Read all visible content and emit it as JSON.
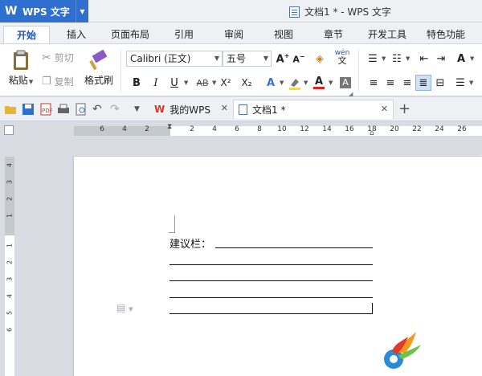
{
  "app": {
    "name": "WPS 文字",
    "window_title": "文档1 * - WPS 文字"
  },
  "ribbon_tabs": [
    {
      "label": "开始",
      "active": true
    },
    {
      "label": "插入"
    },
    {
      "label": "页面布局"
    },
    {
      "label": "引用"
    },
    {
      "label": "审阅"
    },
    {
      "label": "视图"
    },
    {
      "label": "章节"
    },
    {
      "label": "开发工具"
    },
    {
      "label": "特色功能"
    }
  ],
  "ribbon": {
    "paste_label": "粘贴",
    "cut_label": "剪切",
    "copy_label": "复制",
    "format_painter_label": "格式刷",
    "font_name": "Calibri (正文)",
    "font_size": "五号",
    "bold": "B",
    "italic": "I",
    "underline": "U",
    "strike": "AB",
    "superscript": "X²",
    "subscript": "X₂",
    "font_color_letter": "A",
    "pinyin_label": "wén",
    "pinyin_char": "文"
  },
  "quick_access": {
    "doc_tabs": [
      {
        "label": "我的WPS",
        "active": false
      },
      {
        "label": "文档1 *",
        "active": true
      }
    ],
    "new_tab": "+"
  },
  "ruler_labels": [
    "6",
    "4",
    "2",
    "2",
    "4",
    "6",
    "8",
    "10",
    "12",
    "14",
    "16",
    "18",
    "20",
    "22",
    "24",
    "26"
  ],
  "vruler_labels": [
    "4",
    "3",
    "2",
    "1",
    "1",
    "2",
    "3",
    "4",
    "5",
    "6"
  ],
  "document": {
    "label": "建议栏："
  },
  "colors": {
    "accent": "#2f6fd0",
    "highlight": "#f7e500",
    "font_color": "#e02020"
  }
}
